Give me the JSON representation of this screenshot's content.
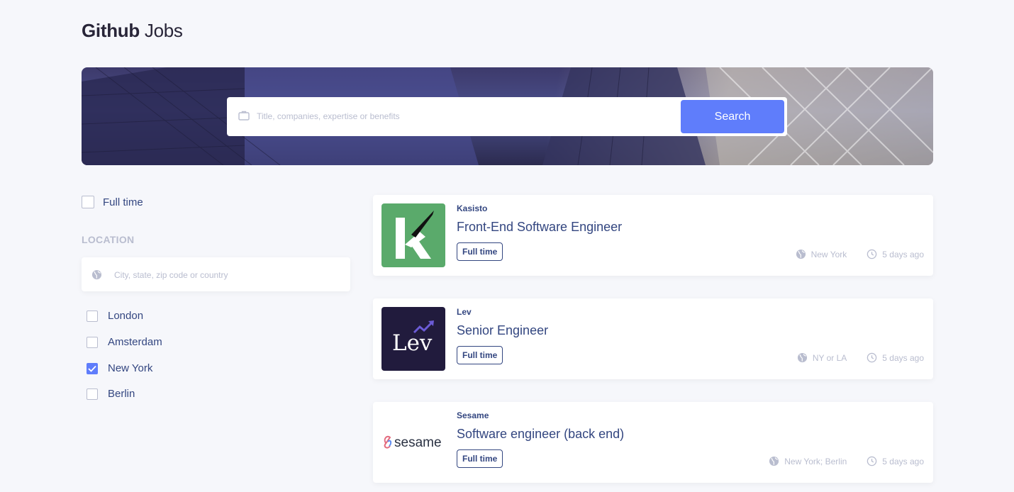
{
  "header": {
    "title_bold": "Github",
    "title_light": "Jobs"
  },
  "search": {
    "placeholder": "Title, companies, expertise or benefits",
    "button_label": "Search"
  },
  "filters": {
    "full_time_label": "Full time",
    "full_time_checked": false,
    "location_heading": "LOCATION",
    "location_placeholder": "City, state, zip code or country",
    "locations": [
      {
        "label": "London",
        "checked": false
      },
      {
        "label": "Amsterdam",
        "checked": false
      },
      {
        "label": "New York",
        "checked": true
      },
      {
        "label": "Berlin",
        "checked": false
      }
    ]
  },
  "jobs": [
    {
      "company": "Kasisto",
      "title": "Front-End Software Engineer",
      "badge": "Full time",
      "location": "New York",
      "posted": "5 days ago",
      "logo_text": "k",
      "logo_bg": "#5aaa6b"
    },
    {
      "company": "Lev",
      "title": "Senior Engineer",
      "badge": "Full time",
      "location": "NY or LA",
      "posted": "5 days ago",
      "logo_text": "Lev",
      "logo_bg": "#211b3d"
    },
    {
      "company": "Sesame",
      "title": "Software engineer (back end)",
      "badge": "Full time",
      "location": "New York; Berlin",
      "posted": "5 days ago",
      "logo_text": "sesame",
      "logo_bg": "#ffffff"
    }
  ],
  "colors": {
    "accent": "#5f7dfb",
    "text": "#334680",
    "muted": "#b9bdcf",
    "background": "#f6f7fb"
  },
  "icons": {
    "search_field": "briefcase-icon",
    "location_field": "globe-icon",
    "job_location": "globe-icon",
    "job_posted": "clock-icon"
  }
}
